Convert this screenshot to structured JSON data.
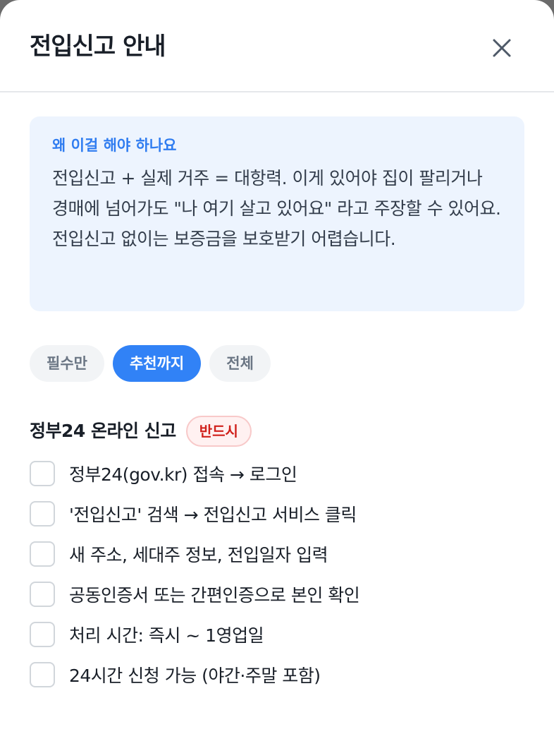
{
  "dialog": {
    "title": "전입신고 안내",
    "close_icon": "close-icon"
  },
  "info_box": {
    "heading": "왜 이걸 해야 하나요",
    "body": "전입신고 + 실제 거주 = 대항력. 이게 있어야 집이 팔리거나 경매에 넘어가도 \"나 여기 살고 있어요\" 라고 주장할 수 있어요. 전입신고 없이는 보증금을 보호받기 어렵습니다."
  },
  "filters": [
    {
      "label": "필수만",
      "selected": false
    },
    {
      "label": "추천까지",
      "selected": true
    },
    {
      "label": "전체",
      "selected": false
    }
  ],
  "section": {
    "title": "정부24 온라인 신고",
    "badge": "반드시"
  },
  "checklist": [
    {
      "label": "정부24(gov.kr) 접속 → 로그인",
      "checked": false
    },
    {
      "label": "'전입신고' 검색 → 전입신고 서비스 클릭",
      "checked": false
    },
    {
      "label": "새 주소, 세대주 정보, 전입일자 입력",
      "checked": false
    },
    {
      "label": "공동인증서 또는 간편인증으로 본인 확인",
      "checked": false
    },
    {
      "label": "처리 시간: 즉시 ~ 1영업일",
      "checked": false
    },
    {
      "label": "24시간 신청 가능 (야간·주말 포함)",
      "checked": false
    }
  ],
  "colors": {
    "accent": "#3182f6",
    "info_bg": "#edf4fe",
    "info_heading": "#2f7cf0",
    "badge_text": "#d0201b",
    "badge_bg": "#fff1f1"
  }
}
